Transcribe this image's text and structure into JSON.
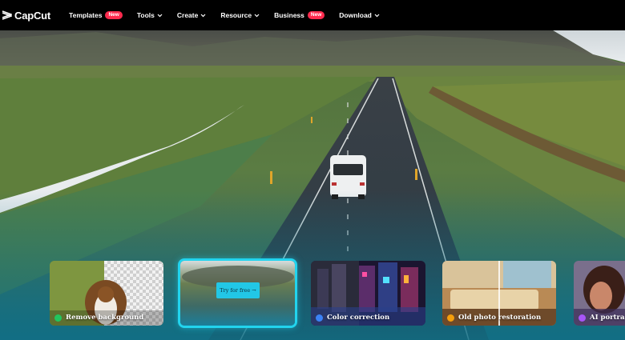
{
  "brand": {
    "name": "CapCut"
  },
  "nav": {
    "items": [
      {
        "label": "Templates",
        "badge": "New",
        "has_chevron": false
      },
      {
        "label": "Tools",
        "has_chevron": true
      },
      {
        "label": "Create",
        "has_chevron": true
      },
      {
        "label": "Resource",
        "has_chevron": true
      },
      {
        "label": "Business",
        "badge": "New",
        "has_chevron": false
      },
      {
        "label": "Download",
        "has_chevron": true
      }
    ]
  },
  "cards": [
    {
      "label": "Remove background",
      "icon": "remove-background-icon",
      "icon_color": "#22c55e"
    },
    {
      "label": "",
      "button": "Try for free →",
      "active": true
    },
    {
      "label": "Color correction",
      "icon": "color-correction-icon",
      "icon_color": "#3b82f6"
    },
    {
      "label": "Old photo restoration",
      "icon": "photo-restoration-icon",
      "icon_color": "#f59e0b"
    },
    {
      "label": "AI portra",
      "icon": "ai-portrait-icon",
      "icon_color": "#a855f7"
    }
  ],
  "colors": {
    "accent": "#22d4ee",
    "badge": "#ff2b4e",
    "nav_bg": "#000000"
  }
}
